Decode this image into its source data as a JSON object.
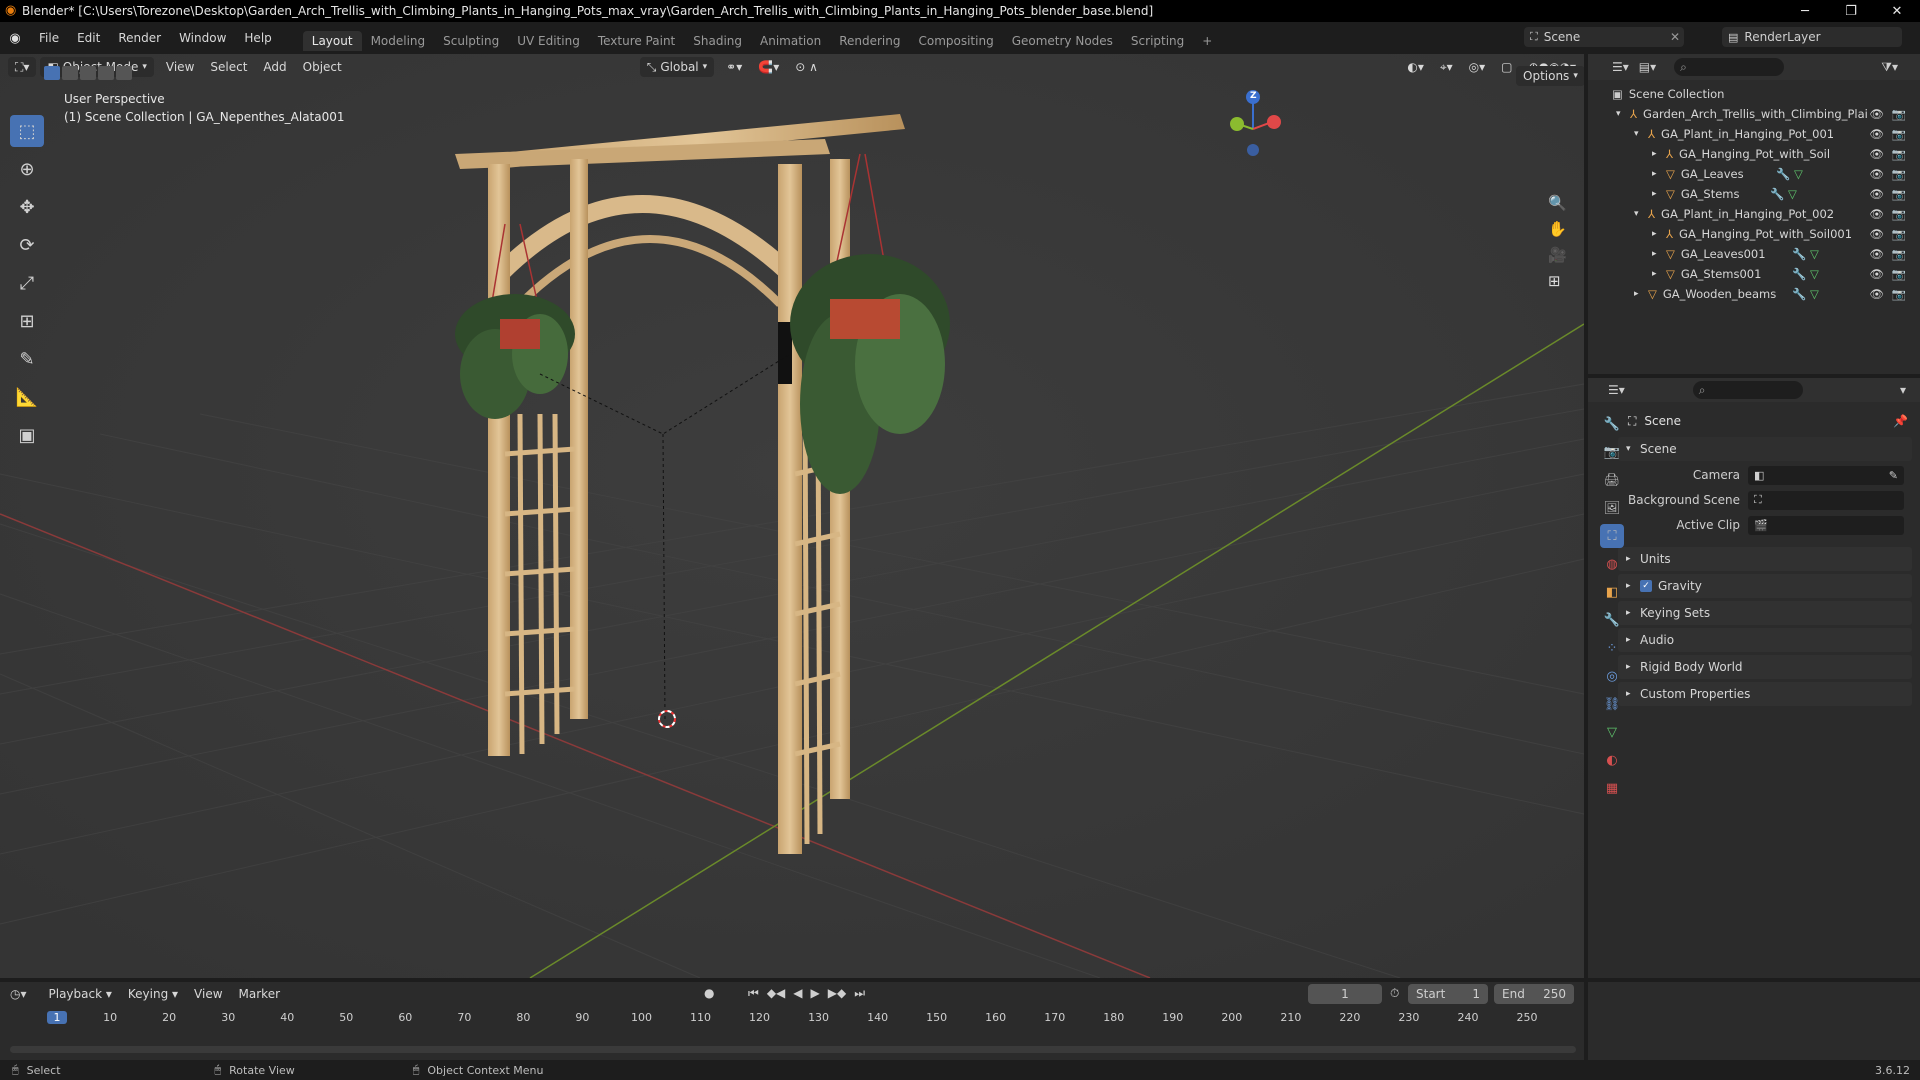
{
  "window": {
    "title": "Blender* [C:\\Users\\Torezone\\Desktop\\Garden_Arch_Trellis_with_Climbing_Plants_in_Hanging_Pots_max_vray\\Garden_Arch_Trellis_with_Climbing_Plants_in_Hanging_Pots_blender_base.blend]",
    "minimize": "─",
    "maximize": "❐",
    "close": "✕"
  },
  "menu": [
    "File",
    "Edit",
    "Render",
    "Window",
    "Help"
  ],
  "workspaces": [
    "Layout",
    "Modeling",
    "Sculpting",
    "UV Editing",
    "Texture Paint",
    "Shading",
    "Animation",
    "Rendering",
    "Compositing",
    "Geometry Nodes",
    "Scripting",
    "+"
  ],
  "top_right": {
    "scene": "Scene",
    "render_layer": "RenderLayer"
  },
  "viewport": {
    "mode": "Object Mode",
    "menus": [
      "View",
      "Select",
      "Add",
      "Object"
    ],
    "transform": "Global",
    "options": "Options",
    "perspective": "User Perspective",
    "collection_info": "(1) Scene Collection | GA_Nepenthes_Alata001",
    "gizmo_z": "Z"
  },
  "outliner": {
    "root": "Scene Collection",
    "rows": [
      {
        "label": "Garden_Arch_Trellis_with_Climbing_Plai"
      },
      {
        "label": "GA_Plant_in_Hanging_Pot_001"
      },
      {
        "label": "GA_Hanging_Pot_with_Soil"
      },
      {
        "label": "GA_Leaves"
      },
      {
        "label": "GA_Stems"
      },
      {
        "label": "GA_Plant_in_Hanging_Pot_002"
      },
      {
        "label": "GA_Hanging_Pot_with_Soil001"
      },
      {
        "label": "GA_Leaves001"
      },
      {
        "label": "GA_Stems001"
      },
      {
        "label": "GA_Wooden_beams"
      }
    ]
  },
  "properties": {
    "header": "Scene",
    "section": "Scene",
    "fields": [
      {
        "label": "Camera"
      },
      {
        "label": "Background Scene"
      },
      {
        "label": "Active Clip"
      }
    ],
    "panels": [
      "Units",
      "Gravity",
      "Keying Sets",
      "Audio",
      "Rigid Body World",
      "Custom Properties"
    ],
    "gravity_checked": true
  },
  "timeline": {
    "menus": [
      "Playback",
      "Keying",
      "View",
      "Marker"
    ],
    "current_frame": "1",
    "start_label": "Start",
    "start": "1",
    "end_label": "End",
    "end": "250",
    "ticks": [
      "1",
      "10",
      "20",
      "30",
      "40",
      "50",
      "60",
      "70",
      "80",
      "90",
      "100",
      "110",
      "120",
      "130",
      "140",
      "150",
      "160",
      "170",
      "180",
      "190",
      "200",
      "210",
      "220",
      "230",
      "240",
      "250"
    ]
  },
  "status": {
    "select": "Select",
    "rotate": "Rotate View",
    "context": "Object Context Menu",
    "version": "3.6.12"
  },
  "colors": {
    "accent": "#4772b3",
    "grid_x": "#8a3a3a",
    "grid_y": "#6a8a2a",
    "wood": "#d9b98a"
  }
}
